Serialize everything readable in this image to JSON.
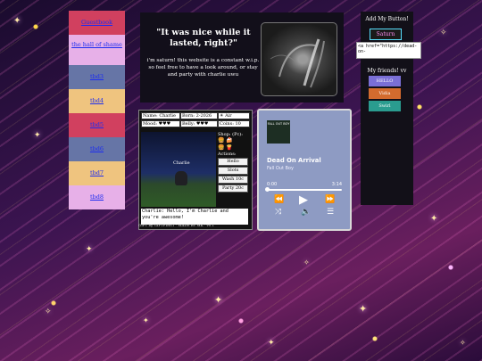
{
  "nav": {
    "items": [
      {
        "label": "Guestbook",
        "color": "#d1405f"
      },
      {
        "label": "the hall of shame",
        "color": "#e7b0e8"
      },
      {
        "label": "tbd3",
        "color": "#6675a6"
      },
      {
        "label": "tbd4",
        "color": "#efc47f"
      },
      {
        "label": "tbd5",
        "color": "#d1405f"
      },
      {
        "label": "tbd6",
        "color": "#6675a6"
      },
      {
        "label": "tbd7",
        "color": "#efc47f"
      },
      {
        "label": "tbd8",
        "color": "#e7b0e8"
      }
    ]
  },
  "hero": {
    "quote": "\"It was nice while it lasted, right?\"",
    "description": "i'm saturn! this website is a constant w.i.p. so feel free to have a look around, or stay and party with charlie uwu"
  },
  "game": {
    "name": "Name: Charlie",
    "born": "Born: 2-2026",
    "element": "Air",
    "mood": "Mood: ♥♥♥",
    "belly": "Belly: ♥♥♥",
    "coins": "Coins: 10",
    "character_label": "Charlie",
    "shop_title": "Shop: (Pc):",
    "actions_title": "Actions:",
    "actions": [
      "Hello",
      "Slots",
      "Wash 10c",
      "Party 20c"
    ],
    "dialog": "Charlie: Hello, I'm Charlie and you're awesome!",
    "credit": "GIFT by GIFTFIRST · MADE BY MK · v0.1"
  },
  "player": {
    "song": "Dead On Arrival",
    "artist": "Fall Out Boy",
    "album_art_label": "FALL OUT BOY",
    "time_current": "0:00",
    "time_total": "3:14",
    "progress": 0
  },
  "sidebar": {
    "button_heading": "Add My Button!",
    "my_button_label": "Saturn",
    "embed_code": "<a href=\"https://dead-on-",
    "friends_heading": "My friends! vv",
    "friends": [
      {
        "label": "HELLO",
        "color": "#7a6fd6"
      },
      {
        "label": "Vidia",
        "color": "#d36b2e"
      },
      {
        "label": "Swirl",
        "color": "#2a9c8f"
      }
    ]
  }
}
